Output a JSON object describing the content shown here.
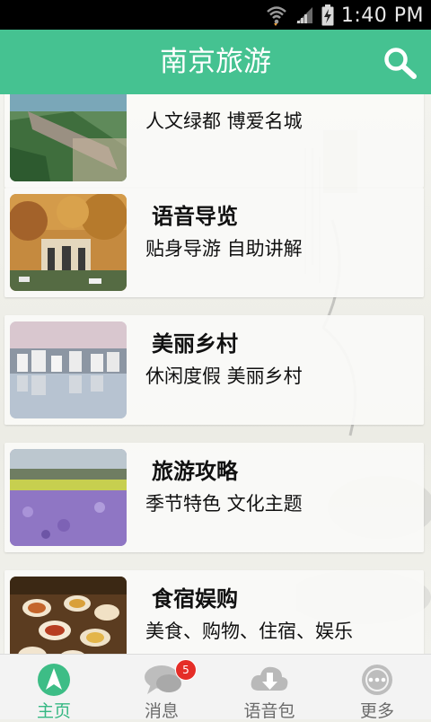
{
  "status_bar": {
    "time": "1:40 PM",
    "icons": [
      "wifi-icon",
      "signal-icon",
      "battery-charging-icon"
    ]
  },
  "app_bar": {
    "title": "南京旅游",
    "search_icon": "search-icon",
    "color": "#45c291"
  },
  "cards": [
    {
      "title": "",
      "subtitle": "人文绿都 博爱名城",
      "image": "city-wall-thumbnail"
    },
    {
      "title": "语音导览",
      "subtitle": "贴身导游 自助讲解",
      "image": "gate-thumbnail"
    },
    {
      "title": "美丽乡村",
      "subtitle": "休闲度假 美丽乡村",
      "image": "village-thumbnail"
    },
    {
      "title": "旅游攻略",
      "subtitle": "季节特色 文化主题",
      "image": "flower-field-thumbnail"
    },
    {
      "title": "食宿娱购",
      "subtitle": "美食、购物、住宿、娱乐",
      "image": "food-thumbnail"
    }
  ],
  "tab_bar": {
    "tabs": [
      {
        "label": "主页",
        "icon": "navigation-arrow-icon",
        "active": true
      },
      {
        "label": "消息",
        "icon": "chat-bubble-icon",
        "badge": "5"
      },
      {
        "label": "语音包",
        "icon": "cloud-download-icon"
      },
      {
        "label": "更多",
        "icon": "more-dots-icon"
      }
    ]
  }
}
